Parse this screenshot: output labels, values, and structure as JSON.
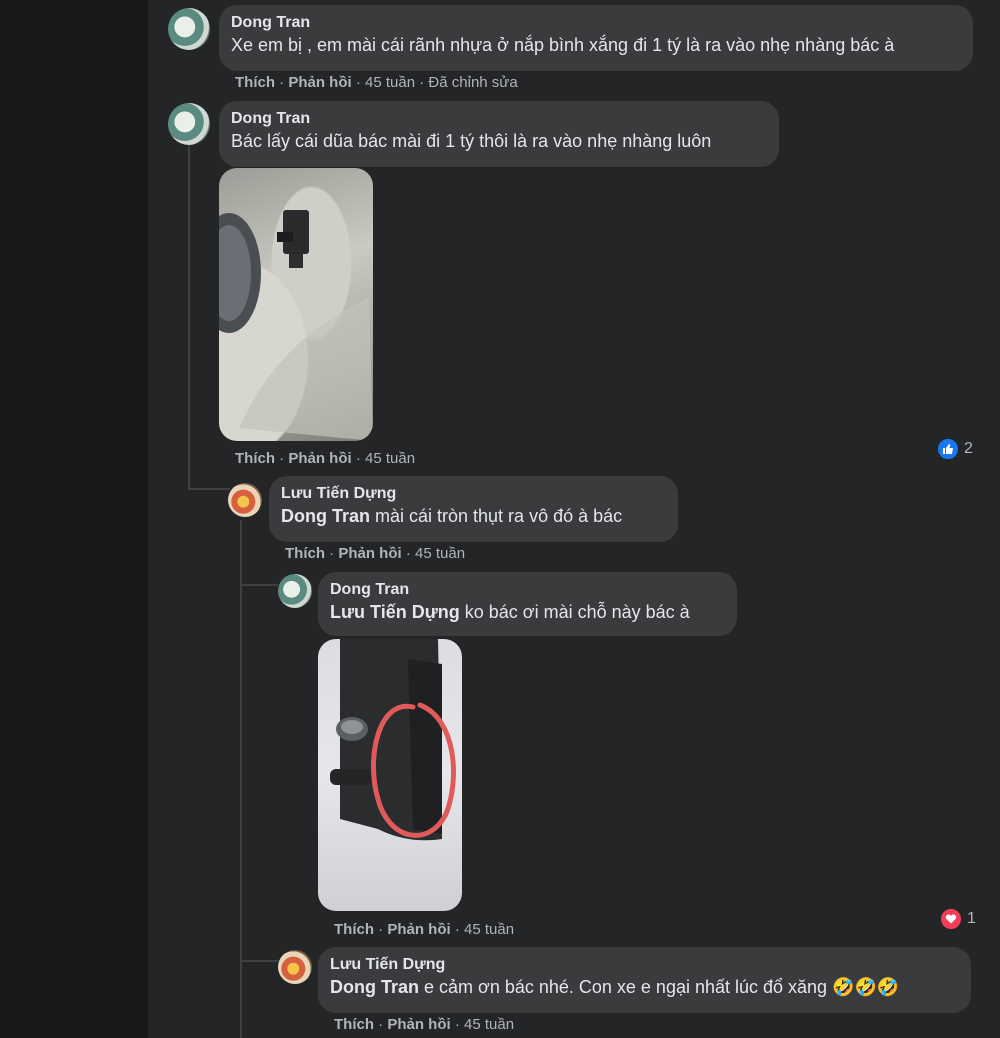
{
  "comments": [
    {
      "author": "Dong Tran",
      "text": "Xe em bị , em mài cái rãnh nhựa ở nắp bình xắng đi 1 tý là ra vào nhẹ nhàng bác à",
      "like": "Thích",
      "reply": "Phản hồi",
      "time": "45 tuần",
      "edited": "Đã chỉnh sửa"
    },
    {
      "author": "Dong Tran",
      "text": "Bác lấy cái dũa bác mài đi 1 tý thôi là ra vào nhẹ nhàng luôn",
      "like": "Thích",
      "reply": "Phản hồi",
      "time": "45 tuần",
      "reaction_icon": "like-icon",
      "reaction_count": "2"
    },
    {
      "author": "Lưu Tiến Dựng",
      "mention": "Dong Tran",
      "text": " mài cái tròn thụt ra vô đó à bác",
      "like": "Thích",
      "reply": "Phản hồi",
      "time": "45 tuần"
    },
    {
      "author": "Dong Tran",
      "mention": "Lưu Tiến Dựng",
      "text": " ko bác ơi mài chỗ này bác à",
      "like": "Thích",
      "reply": "Phản hồi",
      "time": "45 tuần",
      "reaction_icon": "heart-icon",
      "reaction_count": "1"
    },
    {
      "author": "Lưu Tiến Dựng",
      "mention": "Dong Tran",
      "text": " e cảm ơn bác nhé. Con xe e ngại nhất lúc đổ xăng 🤣🤣🤣",
      "like": "Thích",
      "reply": "Phản hồi",
      "time": "45 tuần"
    }
  ],
  "colors": {
    "background": "#242526",
    "bubble": "#3a3b3c",
    "like_blue": "#1877f2",
    "love_red": "#f33e58",
    "circle_annotation": "#e05a5a"
  }
}
